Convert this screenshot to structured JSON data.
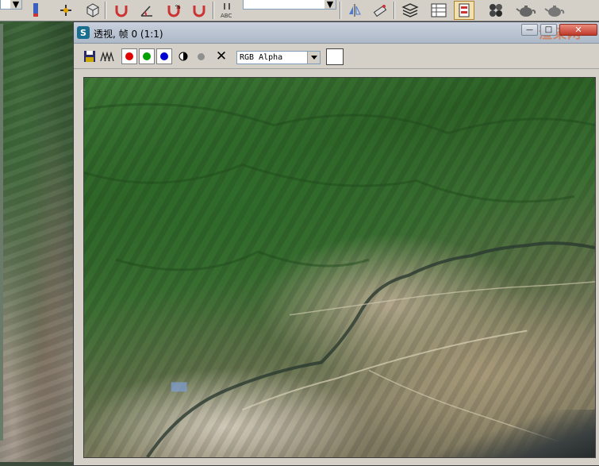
{
  "main_toolbar": {
    "icons": [
      "dropdown-arrow",
      "paint-icon",
      "move-gizmo-icon",
      "box-icon",
      "magnet-icon",
      "angle-snap-icon",
      "percent-snap-icon",
      "spinner-snap-icon",
      "text-abc-icon",
      "named-selection-dropdown",
      "mirror-icon",
      "align-icon",
      "layers-icon",
      "schematic-icon",
      "curve-editor-icon",
      "material-editor-icon",
      "teapot-render-icon",
      "teapot-quick-render-icon"
    ]
  },
  "render_window": {
    "title": "透视, 帧 0 (1:1)",
    "title_icon_glyph": "S",
    "watermark": "渲染网",
    "buttons": {
      "minimize": "—",
      "maximize": "□",
      "close": "✕"
    }
  },
  "frame_toolbar": {
    "channel_select_value": "RGB Alpha",
    "clear_glyph": "✕",
    "swatch_color": "#ffffff",
    "channel_colors": {
      "red": "#e00000",
      "green": "#00a000",
      "blue": "#0000d0"
    }
  }
}
